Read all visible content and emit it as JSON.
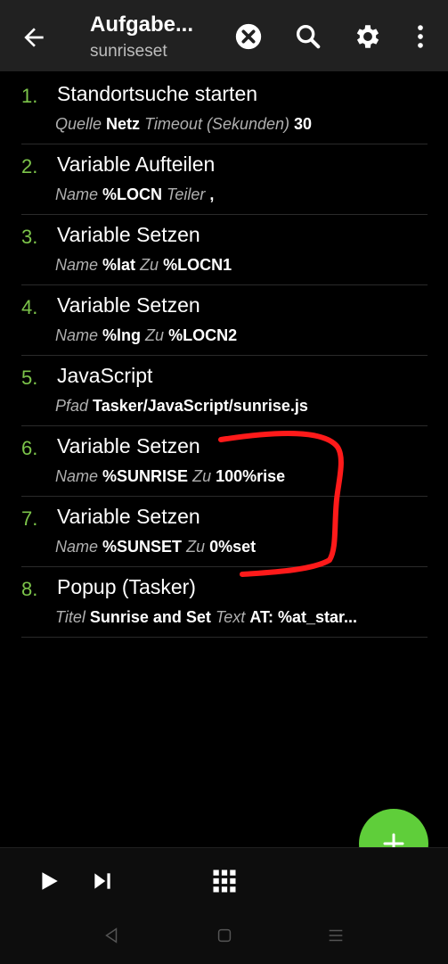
{
  "header": {
    "title": "Aufgabe...",
    "subtitle": "sunriseset",
    "icons": [
      "back-arrow-icon",
      "close-circle-icon",
      "search-icon",
      "settings-gear-icon",
      "more-vert-icon"
    ]
  },
  "actions": [
    {
      "number": "1.",
      "name": "Standortsuche starten",
      "params": [
        {
          "key": "Quelle",
          "value": "Netz"
        },
        {
          "key": "Timeout (Sekunden)",
          "value": "30"
        }
      ]
    },
    {
      "number": "2.",
      "name": "Variable Aufteilen",
      "params": [
        {
          "key": "Name",
          "value": "%LOCN"
        },
        {
          "key": "Teiler",
          "value": ","
        }
      ]
    },
    {
      "number": "3.",
      "name": "Variable Setzen",
      "params": [
        {
          "key": "Name",
          "value": "%lat"
        },
        {
          "key": "Zu",
          "value": "%LOCN1"
        }
      ]
    },
    {
      "number": "4.",
      "name": "Variable Setzen",
      "params": [
        {
          "key": "Name",
          "value": "%lng"
        },
        {
          "key": "Zu",
          "value": "%LOCN2"
        }
      ]
    },
    {
      "number": "5.",
      "name": "JavaScript",
      "params": [
        {
          "key": "Pfad",
          "value": "Tasker/JavaScript/sunrise.js"
        }
      ]
    },
    {
      "number": "6.",
      "name": "Variable Setzen",
      "params": [
        {
          "key": "Name",
          "value": "%SUNRISE"
        },
        {
          "key": "Zu",
          "value": "100%rise"
        }
      ]
    },
    {
      "number": "7.",
      "name": "Variable Setzen",
      "params": [
        {
          "key": "Name",
          "value": "%SUNSET"
        },
        {
          "key": "Zu",
          "value": "0%set"
        }
      ]
    },
    {
      "number": "8.",
      "name": "Popup (Tasker)",
      "params": [
        {
          "key": "Titel",
          "value": "Sunrise and Set"
        },
        {
          "key": "Text",
          "value": "AT: %at_star..."
        }
      ]
    }
  ],
  "colors": {
    "accent_green": "#5fce3a",
    "number_green": "#7cc44a",
    "annotation_red": "#ff1a1a",
    "appbar": "#212121"
  },
  "bottom_bar": {
    "icons": [
      "play-icon",
      "skip-next-icon",
      "grid-icon"
    ]
  },
  "fab": {
    "icon": "plus-icon"
  },
  "system_nav": {
    "icons": [
      "nav-back-icon",
      "nav-home-icon",
      "nav-recents-icon"
    ]
  }
}
